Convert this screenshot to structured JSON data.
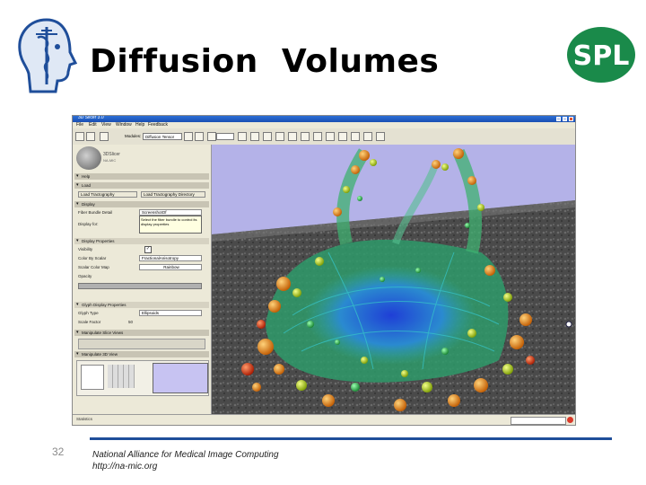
{
  "slide": {
    "title": "Diffusion  Volumes",
    "slide_number": "32",
    "footer_line1": "National Alliance for Medical Image Computing",
    "footer_line2": "http://na-mic.org",
    "logo_right_text": "SPL",
    "accent_color": "#1f4e9a",
    "logo_green": "#1a8a4a"
  },
  "screenshot": {
    "window_title": "3D Slicer 3.0",
    "menu": [
      "File",
      "Edit",
      "View",
      "Window",
      "Help",
      "Feedback"
    ],
    "toolbar": {
      "modules_label": "Modules:",
      "module_value": "Diffusion Tensor",
      "combo2": ""
    },
    "panel": {
      "logo_text": "3DSlicer",
      "logo_sub": "NA-MIC",
      "sections": [
        "Help",
        "Load",
        "Display",
        "Display Properties",
        "Manipulate Slice Views",
        "Manipulate 3D View"
      ],
      "load_buttons": [
        "Load Tractography",
        "Load Tractography Directory"
      ],
      "fields": [
        {
          "label": "Fiber Bundle Detail",
          "value": "ScreenshotOf"
        },
        {
          "label": "Display for:",
          "value": ""
        },
        {
          "label": "Visibility",
          "value": ""
        },
        {
          "label": "Color By Scalar",
          "value": "FractionalAnisotropy"
        },
        {
          "label": "Scalar Color Map",
          "value": "Rainbow"
        },
        {
          "label": "Opacity",
          "value": ""
        },
        {
          "label": "Glyph Display Properties",
          "value": ""
        },
        {
          "label": "Glyph Type",
          "value": "Ellipsoids"
        },
        {
          "label": "Scale Factor",
          "value": "50"
        }
      ],
      "tooltip": "Select the fiber bundle to control its display properties"
    },
    "status": "Statistics"
  }
}
